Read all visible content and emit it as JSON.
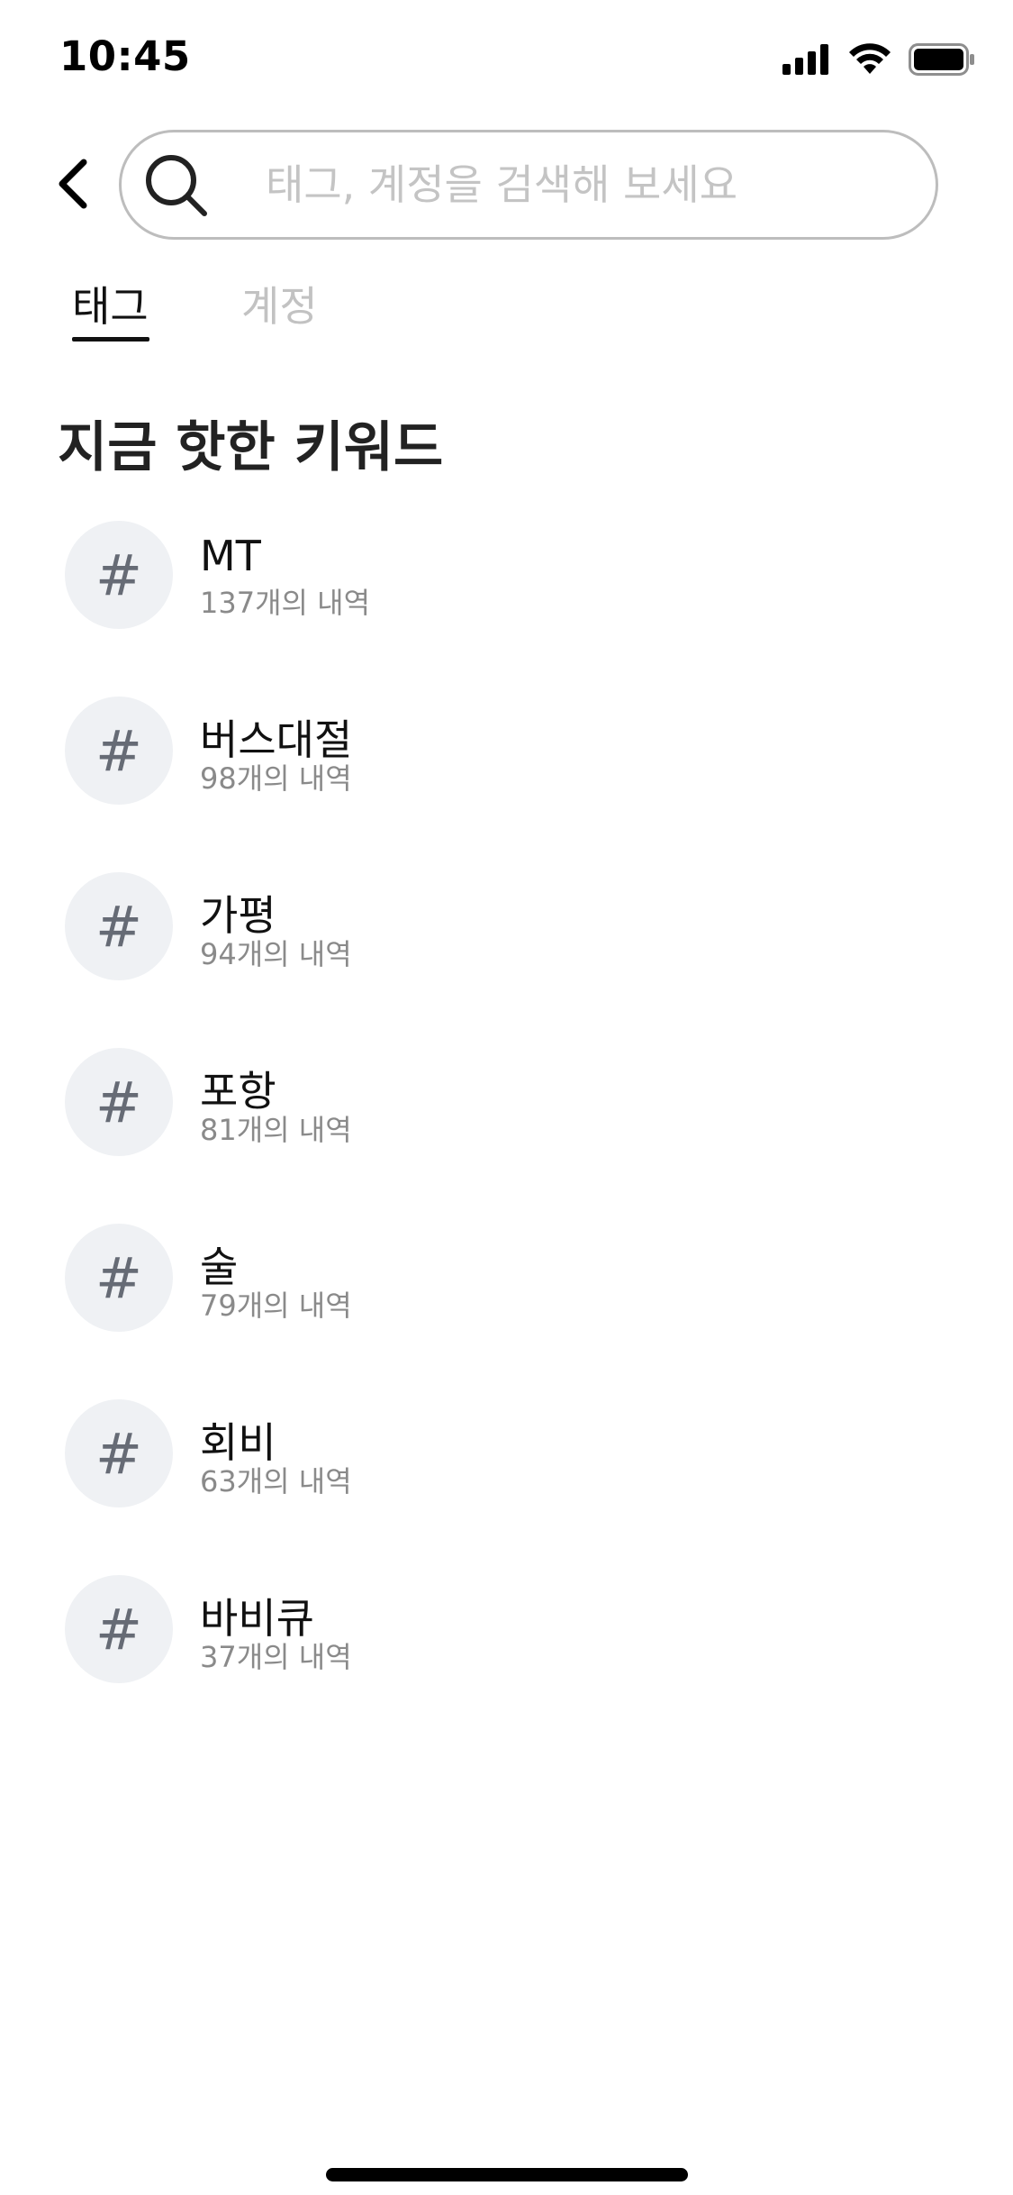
{
  "status_bar": {
    "time": "10:45",
    "icons": [
      "cellular-signal-icon",
      "wifi-icon",
      "battery-icon"
    ]
  },
  "search": {
    "placeholder": "태그, 계정을 검색해 보세요",
    "value": ""
  },
  "tabs": [
    {
      "label": "태그",
      "selected": true
    },
    {
      "label": "계정",
      "selected": false
    }
  ],
  "section": {
    "title": "지금 핫한 키워드"
  },
  "keywords": [
    {
      "icon": "#",
      "name": "MT",
      "count": "137개의 내역"
    },
    {
      "icon": "#",
      "name": "버스대절",
      "count": "98개의 내역"
    },
    {
      "icon": "#",
      "name": "가평",
      "count": "94개의 내역"
    },
    {
      "icon": "#",
      "name": "포항",
      "count": "81개의 내역"
    },
    {
      "icon": "#",
      "name": "술",
      "count": "79개의 내역"
    },
    {
      "icon": "#",
      "name": "회비",
      "count": "63개의 내역"
    },
    {
      "icon": "#",
      "name": "바비큐",
      "count": "37개의 내역"
    }
  ],
  "colors": {
    "search_border": "#bdbdbd",
    "placeholder": "#c4c4c4",
    "tab_inactive": "#c2c2c2",
    "hash_circle_bg": "#eff1f4",
    "hash_glyph": "#666b75",
    "count_text": "#8a8a8a"
  }
}
